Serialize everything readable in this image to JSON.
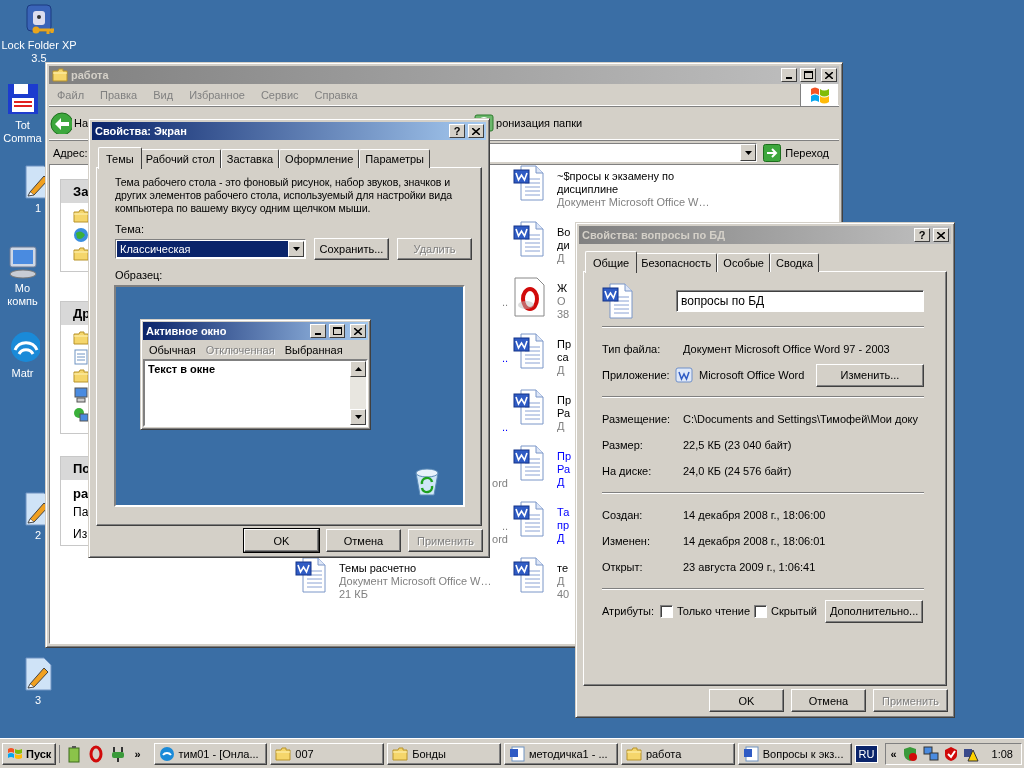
{
  "desktop_icons": [
    {
      "lines": [
        "Lock Folder XP",
        "3.5"
      ],
      "kind": "lock"
    },
    {
      "lines": [
        "Tot",
        "Comma"
      ],
      "kind": "floppy"
    },
    {
      "lines": [
        "1"
      ],
      "kind": "script"
    },
    {
      "lines": [
        "Мо",
        "компь"
      ],
      "kind": "computer"
    },
    {
      "lines": [
        "Matr"
      ],
      "kind": "app"
    },
    {
      "lines": [
        "2"
      ],
      "kind": "script"
    },
    {
      "lines": [
        "3"
      ],
      "kind": "script"
    }
  ],
  "explorer": {
    "title": "работа",
    "active": false,
    "menu": [
      "Файл",
      "Правка",
      "Вид",
      "Избранное",
      "Сервис",
      "Справка"
    ],
    "back_label": "На",
    "sync_label": "ронизация папки",
    "address_label": "Адрес:",
    "go_label": "Переход",
    "panels": [
      {
        "header": "За",
        "kind": "tasks"
      },
      {
        "header": "Др",
        "kind": "places"
      },
      {
        "header": "По",
        "kind": "details",
        "lines": [
          "ра",
          "Па",
          "Из"
        ]
      }
    ],
    "files_left": [
      {
        "line_2": "..",
        "compressed": false
      },
      {
        "line_2": "..",
        "compressed": true
      },
      {
        "line_3": "..",
        "compressed": true
      },
      {
        "line_3": "ord",
        "compressed": false
      },
      {
        "line_2": "..",
        "line_3": "ord",
        "compressed": false
      },
      {
        "name_lines": [
          "Темы расчетно"
        ],
        "detail_lines": [
          "Документ Microsoft Office W…",
          "21 КБ"
        ],
        "kind": "word",
        "compressed": false
      }
    ],
    "files_right": [
      {
        "name_lines": [
          "~$просы к экзамену по",
          "дисциплине"
        ],
        "detail_lines": [
          "Документ Microsoft Office W…"
        ],
        "kind": "word",
        "compressed": false
      },
      {
        "name_lines": [
          "Во",
          "ди"
        ],
        "detail_lines": [
          "Д"
        ],
        "kind": "word",
        "compressed": false
      },
      {
        "name_lines": [
          "Ж"
        ],
        "detail_lines": [
          "О",
          "38"
        ],
        "kind": "opera",
        "compressed": false
      },
      {
        "name_lines": [
          "Пр",
          "са"
        ],
        "detail_lines": [
          "Д"
        ],
        "kind": "word",
        "compressed": false
      },
      {
        "name_lines": [
          "Пр",
          "Ра"
        ],
        "detail_lines": [
          "Д"
        ],
        "kind": "word",
        "compressed": false
      },
      {
        "name_lines": [
          "Пр",
          "Ра"
        ],
        "detail_lines": [
          "Д"
        ],
        "kind": "word",
        "compressed": true
      },
      {
        "name_lines": [
          "Та",
          "пр"
        ],
        "detail_lines": [
          "Д"
        ],
        "kind": "word",
        "compressed": true
      },
      {
        "name_lines": [
          "те"
        ],
        "detail_lines": [
          "Д",
          "40"
        ],
        "kind": "word",
        "compressed": false
      }
    ]
  },
  "display_dialog": {
    "title": "Свойства: Экран",
    "active": true,
    "help": "?",
    "tabs": [
      {
        "label": "Темы",
        "selected": true
      },
      {
        "label": "Рабочий стол",
        "selected": false
      },
      {
        "label": "Заставка",
        "selected": false
      },
      {
        "label": "Оформление",
        "selected": false
      },
      {
        "label": "Параметры",
        "selected": false
      }
    ],
    "description": "Тема рабочего стола - это фоновый рисунок, набор звуков, значков и других элементов рабочего стола, используемый для настройки вида компьютера по вашему вкусу одним щелчком мыши.",
    "theme_label": "Тема:",
    "theme_value": "Классическая",
    "theme_buttons": [
      {
        "label": "Сохранить...",
        "disabled": false
      },
      {
        "label": "Удалить",
        "disabled": true
      }
    ],
    "sample_label": "Образец:",
    "preview": {
      "title": "Активное окно",
      "menu": [
        {
          "label": "Обычная",
          "disabled": false
        },
        {
          "label": "Отключенная",
          "disabled": true
        },
        {
          "label": "Выбранная",
          "disabled": false
        }
      ],
      "body_text": "Текст в окне"
    },
    "buttons": [
      {
        "label": "OK",
        "disabled": false,
        "default": true
      },
      {
        "label": "Отмена",
        "disabled": false,
        "default": false
      },
      {
        "label": "Применить",
        "disabled": true,
        "default": false
      }
    ]
  },
  "file_dialog": {
    "title": "Свойства: вопросы по БД",
    "active": false,
    "help": "?",
    "tabs": [
      {
        "label": "Общие",
        "selected": true
      },
      {
        "label": "Безопасность",
        "selected": false
      },
      {
        "label": "Особые",
        "selected": false
      },
      {
        "label": "Сводка",
        "selected": false
      }
    ],
    "file_name": "вопросы по БД",
    "type_label": "Тип файла:",
    "type_value": "Документ Microsoft Office Word 97 - 2003",
    "app_label": "Приложение:",
    "app_value": "Microsoft Office Word",
    "change_button": "Изменить...",
    "info_rows": [
      {
        "label": "Размещение:",
        "value": "C:\\Documents and Settings\\Тимофей\\Мои доку"
      },
      {
        "label": "Размер:",
        "value": "22,5 КБ (23 040 байт)"
      },
      {
        "label": "На диске:",
        "value": "24,0 КБ (24 576 байт)"
      }
    ],
    "date_rows": [
      {
        "label": "Создан:",
        "value": "14 декабря 2008 г., 18:06:00"
      },
      {
        "label": "Изменен:",
        "value": "14 декабря 2008 г., 18:06:01"
      },
      {
        "label": "Открыт:",
        "value": "23 августа 2009 г., 1:06:41"
      }
    ],
    "attributes_label": "Атрибуты:",
    "attributes": [
      {
        "label": "Только чтение",
        "checked": false
      },
      {
        "label": "Скрытый",
        "checked": false
      }
    ],
    "advanced_button": "Дополнительно...",
    "buttons": [
      {
        "label": "OK",
        "disabled": false,
        "default": false
      },
      {
        "label": "Отмена",
        "disabled": false,
        "default": false
      },
      {
        "label": "Применить",
        "disabled": true,
        "default": false
      }
    ]
  },
  "taskbar": {
    "start": "Пуск",
    "more": "»",
    "tasks": [
      {
        "label": "тим01 - [Онла...",
        "kind": "app",
        "selected": false
      },
      {
        "label": "007",
        "kind": "folder",
        "selected": false
      },
      {
        "label": "Бонды",
        "kind": "folder",
        "selected": false
      },
      {
        "label": "методичка1 - ...",
        "kind": "word",
        "selected": false
      },
      {
        "label": "работа",
        "kind": "folder",
        "selected": false
      },
      {
        "label": "Вопросы к экз...",
        "kind": "word",
        "selected": false
      }
    ],
    "language": "RU",
    "tray_expand": "«",
    "clock": "1:08"
  }
}
